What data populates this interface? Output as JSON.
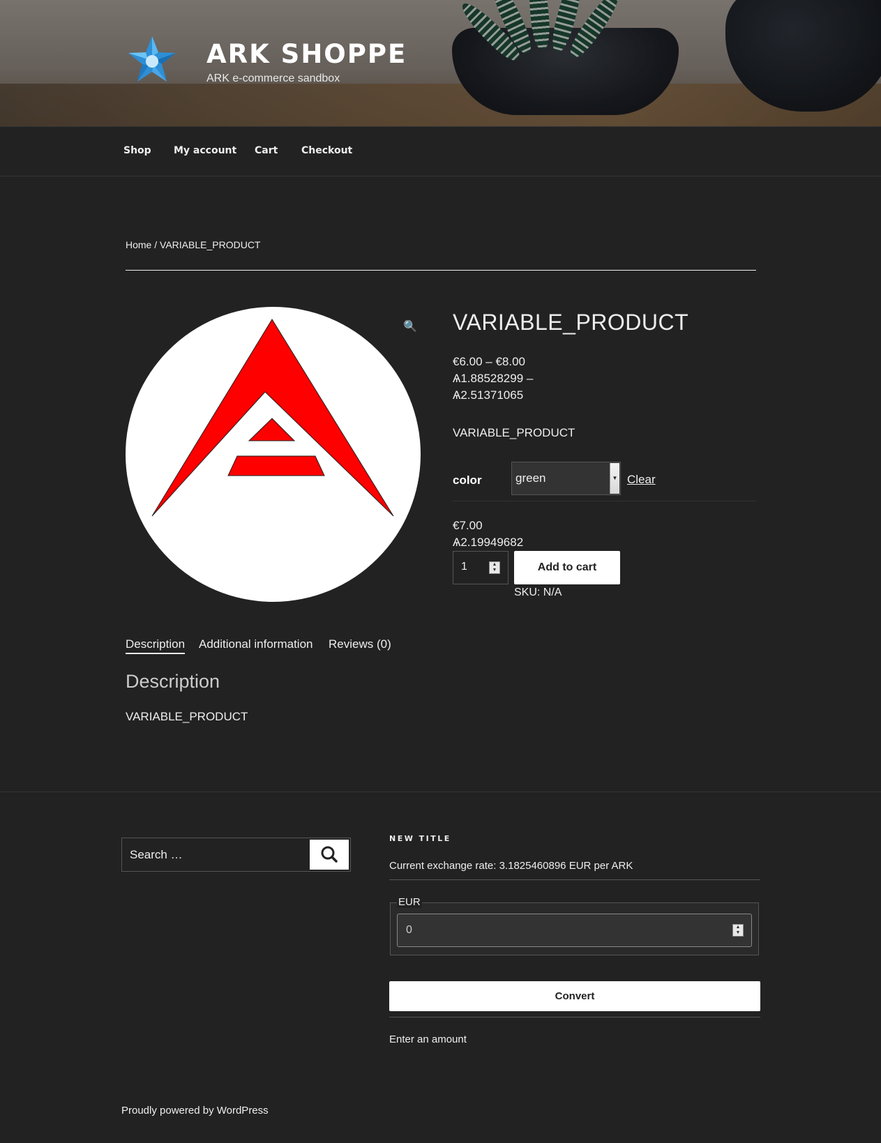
{
  "site": {
    "title": "ARK SHOPPE",
    "description": "ARK e-commerce sandbox",
    "logo_icon": "star-logo-icon"
  },
  "nav": {
    "items": [
      {
        "label": "Shop"
      },
      {
        "label": "My account"
      },
      {
        "label": "Cart"
      },
      {
        "label": "Checkout"
      }
    ]
  },
  "breadcrumb": {
    "home": "Home",
    "separator": " / ",
    "current": "VARIABLE_PRODUCT"
  },
  "product": {
    "title": "VARIABLE_PRODUCT",
    "price_range_eur": "€6.00 – €8.00",
    "price_range_ark_line1": "Ѧ1.88528299 –",
    "price_range_ark_line2": "Ѧ2.51371065",
    "short_description": "VARIABLE_PRODUCT",
    "image_icon": "ark-logo-icon",
    "zoom_icon": "🔍",
    "variation": {
      "label": "color",
      "selected": "green",
      "clear_label": "Clear"
    },
    "variation_price_eur": "€7.00",
    "variation_price_ark": "Ѧ2.19949682",
    "quantity": "1",
    "add_to_cart_label": "Add to cart",
    "sku": "SKU: N/A",
    "accent_color": "#ff0000"
  },
  "tabs": {
    "items": [
      {
        "label": "Description"
      },
      {
        "label": "Additional information"
      },
      {
        "label": "Reviews (0)"
      }
    ],
    "active": "Description",
    "heading": "Description",
    "content": "VARIABLE_PRODUCT"
  },
  "footer": {
    "search_placeholder": "Search …",
    "search_icon": "search-icon",
    "widget_title": "NEW TITLE",
    "exchange_rate": "Current exchange rate: 3.1825460896 EUR per ARK",
    "currency_legend": "EUR",
    "amount_value": "0",
    "convert_label": "Convert",
    "result_text": "Enter an amount",
    "powered_by": "Proudly powered by WordPress"
  }
}
